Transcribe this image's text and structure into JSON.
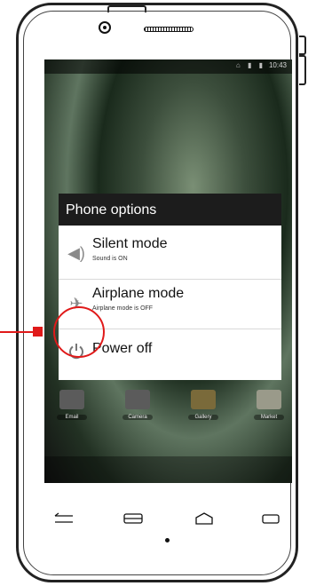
{
  "status_bar": {
    "time": "10:43",
    "icons": "⌂ ▮ ▮"
  },
  "dialog": {
    "title": "Phone options",
    "options": [
      {
        "icon": "speaker-icon",
        "label": "Silent mode",
        "sub": "Sound is ON"
      },
      {
        "icon": "airplane-icon",
        "label": "Airplane mode",
        "sub": "Airplane mode is OFF"
      },
      {
        "icon": "power-icon",
        "label": "Power off",
        "sub": ""
      }
    ]
  },
  "dock": [
    {
      "icon": "email-icon",
      "label": "Email"
    },
    {
      "icon": "camera-icon",
      "label": "Camera"
    },
    {
      "icon": "gallery-icon",
      "label": "Gallery"
    },
    {
      "icon": "market-icon",
      "label": "Market"
    }
  ],
  "hardware_keys": [
    "back-key-icon",
    "menu-key-icon",
    "home-key-icon",
    "search-key-icon"
  ],
  "colors": {
    "callout": "#e01a1a",
    "dialog_title_bg": "#1c1c1c"
  }
}
